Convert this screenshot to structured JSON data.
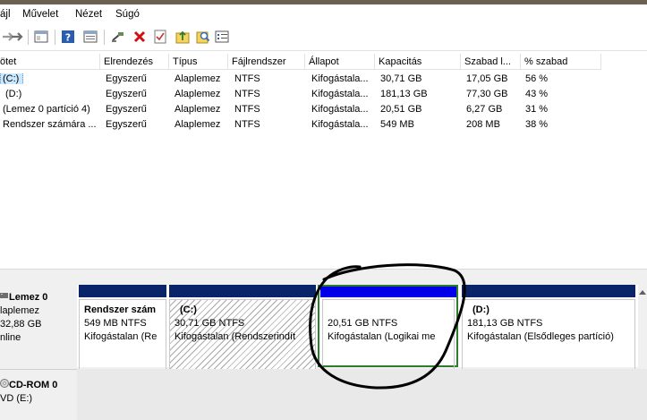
{
  "menu": [
    "ájl",
    "Művelet",
    "Nézet",
    "Súgó"
  ],
  "toolbar": {
    "icons": [
      "back-arrow-icon",
      "forward-arrow-icon",
      "console-tree-icon",
      "help-icon",
      "view-icon",
      "connect-icon",
      "delete-icon",
      "check-icon",
      "folder-up-icon",
      "search-icon",
      "properties-icon"
    ]
  },
  "columns": [
    "ötet",
    "Elrendezés",
    "Típus",
    "Fájlrendszer",
    "Állapot",
    "Kapacitás",
    "Szabad l...",
    "% szabad"
  ],
  "rows": [
    {
      "name": "(C:)",
      "layout": "Egyszerű",
      "type": "Alaplemez",
      "fs": "NTFS",
      "status": "Kifogástala...",
      "capacity": "30,71 GB",
      "free": "17,05 GB",
      "pct": "56 %"
    },
    {
      "name": "(D:)",
      "layout": "Egyszerű",
      "type": "Alaplemez",
      "fs": "NTFS",
      "status": "Kifogástala...",
      "capacity": "181,13 GB",
      "free": "77,30 GB",
      "pct": "43 %"
    },
    {
      "name": "(Lemez 0 partíció 4)",
      "layout": "Egyszerű",
      "type": "Alaplemez",
      "fs": "NTFS",
      "status": "Kifogástala...",
      "capacity": "20,51 GB",
      "free": "6,27 GB",
      "pct": "31 %"
    },
    {
      "name": "Rendszer számára ...",
      "layout": "Egyszerű",
      "type": "Alaplemez",
      "fs": "NTFS",
      "status": "Kifogástala...",
      "capacity": "549 MB",
      "free": "208 MB",
      "pct": "38 %"
    }
  ],
  "disk0": {
    "name": "Lemez 0",
    "type": "laplemez",
    "size": "32,88 GB",
    "state": "nline",
    "partitions": [
      {
        "title": "Rendszer szám",
        "size": "549 MB NTFS",
        "status": "Kifogástalan (Re"
      },
      {
        "title": "(C:)",
        "size": "30,71 GB NTFS",
        "status": "Kifogástalan (Rendszerindít"
      },
      {
        "title": "",
        "size": "20,51 GB NTFS",
        "status": "Kifogástalan (Logikai me"
      },
      {
        "title": "(D:)",
        "size": "181,13 GB NTFS",
        "status": "Kifogástalan (Elsődleges partíció)"
      }
    ]
  },
  "cdrom": {
    "name": "CD-ROM 0",
    "type": "VD (E:)"
  },
  "colors": {
    "primary_bar": "#0a246a",
    "logical_bar": "#0000e8",
    "selection": "#2d7d2d",
    "annotation": "#000000"
  }
}
